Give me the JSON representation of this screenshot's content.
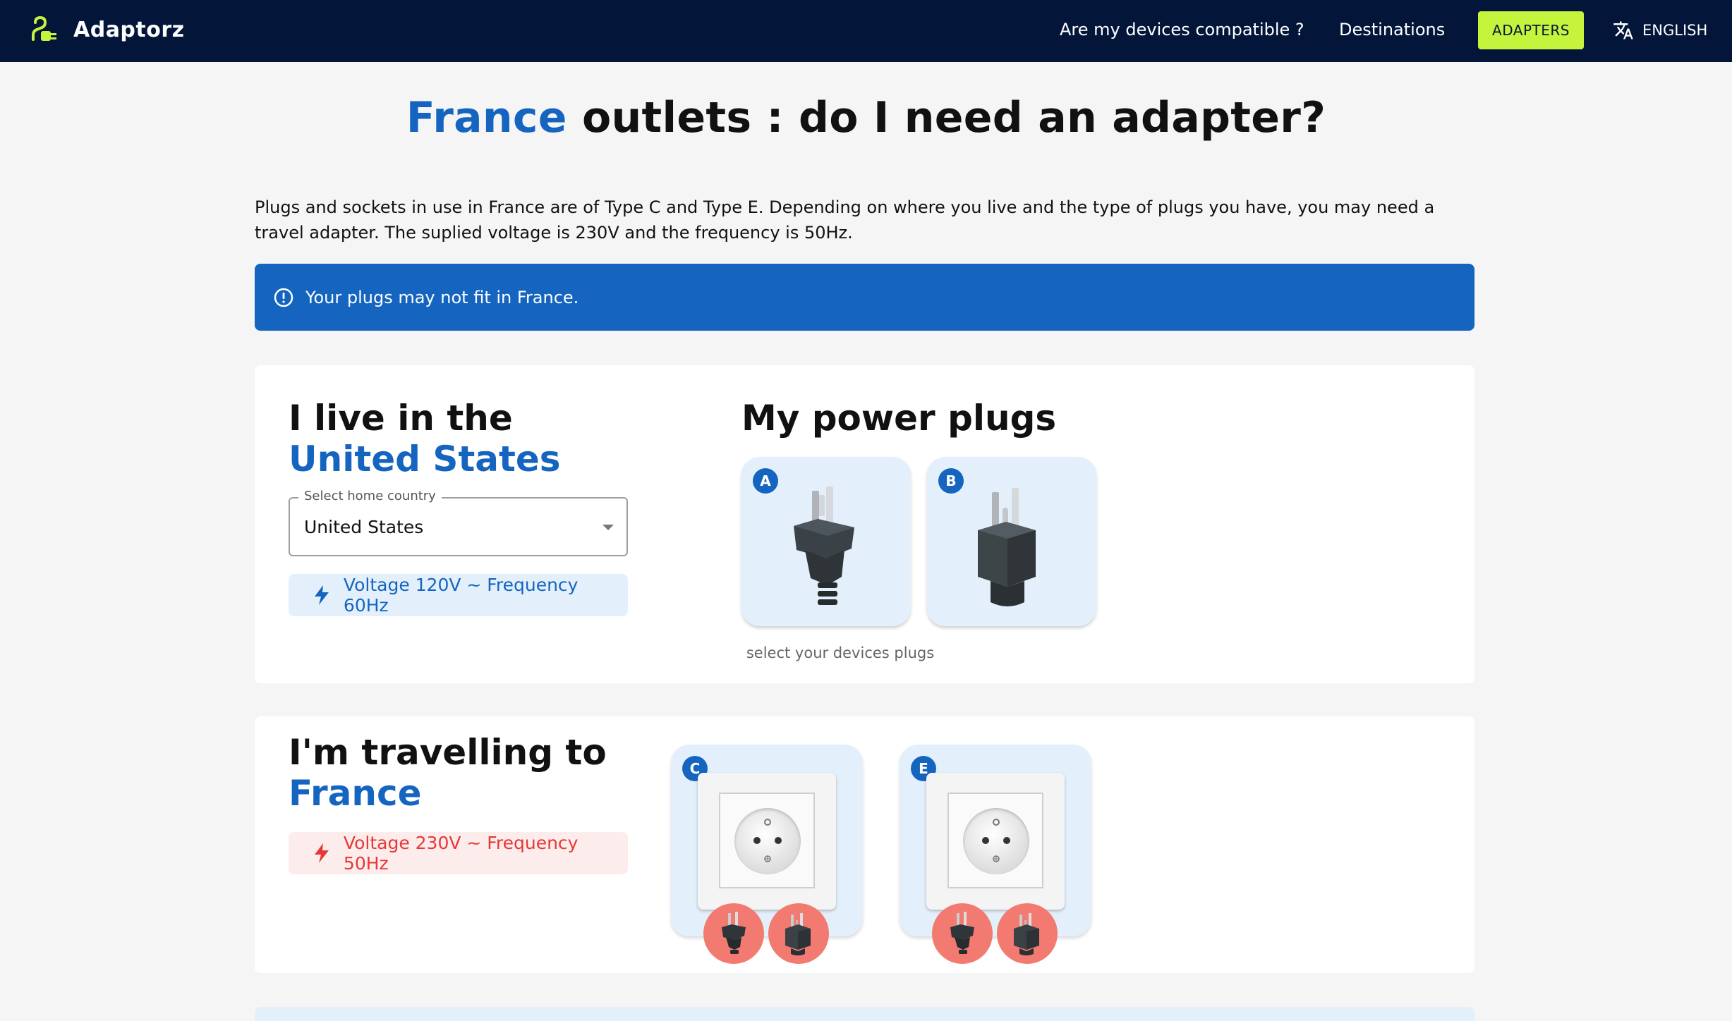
{
  "header": {
    "brand": "Adaptorz",
    "nav_compat": "Are my devices compatible ?",
    "nav_destinations": "Destinations",
    "nav_adapters": "ADAPTERS",
    "language": "ENGLISH"
  },
  "title": {
    "country": "France",
    "rest": " outlets : do I need an adapter?"
  },
  "intro": "Plugs and sockets in use in France are of Type C and Type E. Depending on where you live and the type of plugs you have, you may need a travel adapter. The suplied voltage is 230V and the frequency is 50Hz.",
  "alert": "Your plugs may not fit in France.",
  "home": {
    "heading_prefix": "I live in the ",
    "heading_country": "United States",
    "select_label": "Select home country",
    "select_value": "United States",
    "voltage": "Voltage 120V ~ Frequency 60Hz"
  },
  "plugs": {
    "heading": "My power plugs",
    "items": [
      {
        "type": "A"
      },
      {
        "type": "B"
      }
    ],
    "hint": "select your devices plugs"
  },
  "travel": {
    "heading_prefix": "I'm travelling to",
    "heading_country": "France",
    "voltage": "Voltage 230V ~ Frequency 50Hz",
    "sockets": [
      {
        "type": "C"
      },
      {
        "type": "E"
      }
    ]
  },
  "colors": {
    "navbar": "#03163a",
    "accent": "#1565c0",
    "adapters_button": "#c6f33c",
    "incompatible": "#f27a70",
    "warning_text": "#e53935"
  }
}
